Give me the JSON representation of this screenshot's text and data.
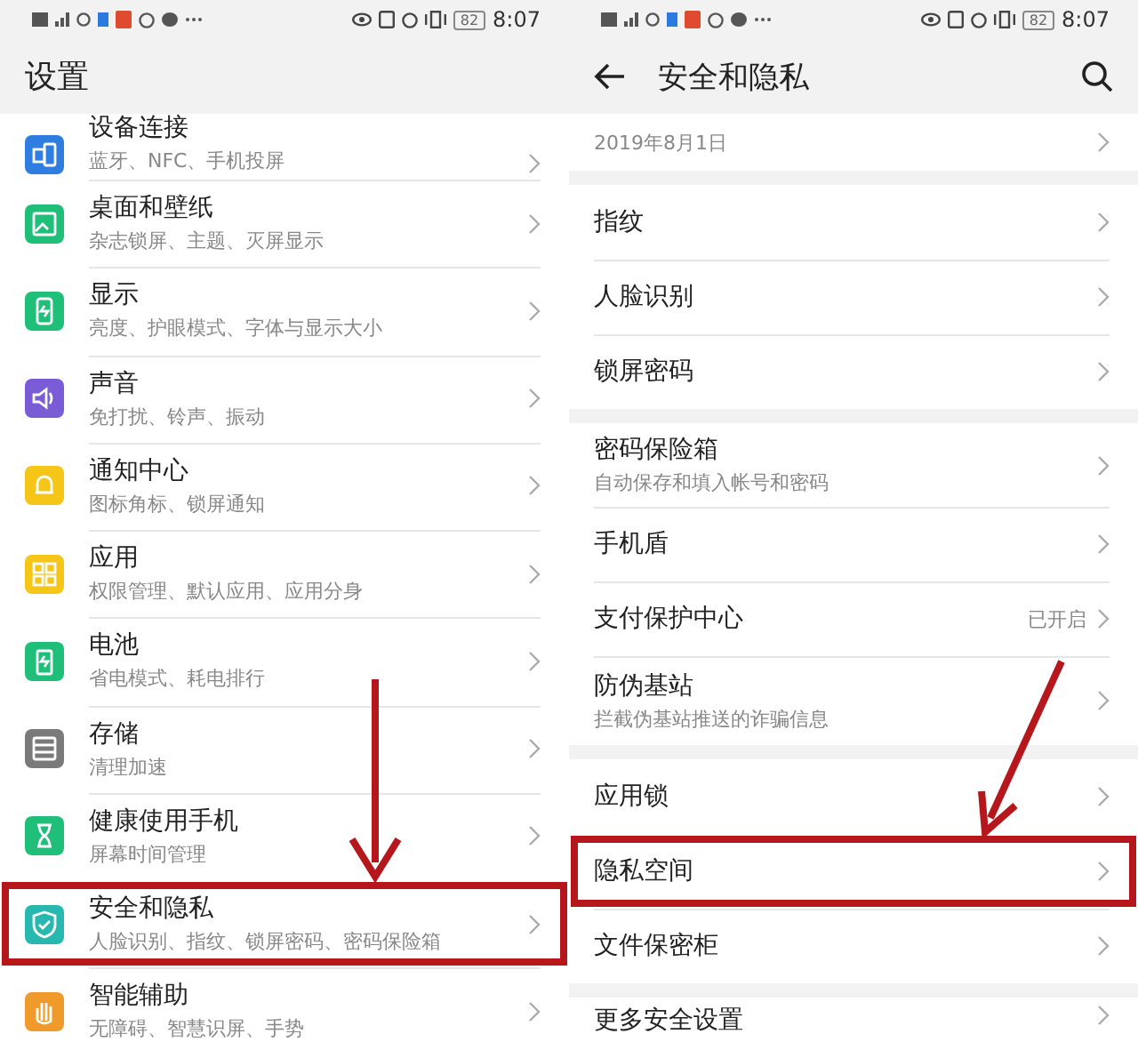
{
  "screens": [
    {
      "status_bar": {
        "battery": "82",
        "time": "8:07"
      },
      "header": {
        "title": "设置",
        "back": false,
        "search": false
      },
      "groups": [
        [
          {
            "title": "设备连接",
            "subtitle": "蓝牙、NFC、手机投屏",
            "color": "#2f7de1",
            "highlighted": false
          },
          {
            "title": "桌面和壁纸",
            "subtitle": "杂志锁屏、主题、灭屏显示",
            "color": "#1fbf7a",
            "highlighted": false
          },
          {
            "title": "显示",
            "subtitle": "亮度、护眼模式、字体与显示大小",
            "color": "#1fbf7a",
            "highlighted": false
          },
          {
            "title": "声音",
            "subtitle": "免打扰、铃声、振动",
            "color": "#7a5cd6",
            "highlighted": false
          },
          {
            "title": "通知中心",
            "subtitle": "图标角标、锁屏通知",
            "color": "#f5c518",
            "highlighted": false
          },
          {
            "title": "应用",
            "subtitle": "权限管理、默认应用、应用分身",
            "color": "#f5c518",
            "highlighted": false
          },
          {
            "title": "电池",
            "subtitle": "省电模式、耗电排行",
            "color": "#1fbf7a",
            "highlighted": false
          },
          {
            "title": "存储",
            "subtitle": "清理加速",
            "color": "#7a7a7a",
            "highlighted": false
          },
          {
            "title": "健康使用手机",
            "subtitle": "屏幕时间管理",
            "color": "#1fbf7a",
            "highlighted": false
          },
          {
            "title": "安全和隐私",
            "subtitle": "人脸识别、指纹、锁屏密码、密码保险箱",
            "color": "#27b8b0",
            "highlighted": true
          },
          {
            "title": "智能辅助",
            "subtitle": "无障碍、智慧识屏、手势",
            "color": "#f09a2c",
            "highlighted": false
          }
        ]
      ]
    },
    {
      "status_bar": {
        "battery": "82",
        "time": "8:07"
      },
      "header": {
        "title": "安全和隐私",
        "back": true,
        "search": true
      },
      "groups": [
        [
          {
            "subtitle": "2019年8月1日",
            "highlighted": false
          }
        ],
        [
          {
            "title": "指纹",
            "highlighted": false
          },
          {
            "title": "人脸识别",
            "highlighted": false
          },
          {
            "title": "锁屏密码",
            "highlighted": false
          }
        ],
        [
          {
            "title": "密码保险箱",
            "subtitle": "自动保存和填入帐号和密码",
            "highlighted": false
          },
          {
            "title": "手机盾",
            "highlighted": false
          },
          {
            "title": "支付保护中心",
            "value": "已开启",
            "highlighted": false
          },
          {
            "title": "防伪基站",
            "subtitle": "拦截伪基站推送的诈骗信息",
            "highlighted": false
          }
        ],
        [
          {
            "title": "应用锁",
            "highlighted": false
          },
          {
            "title": "隐私空间",
            "highlighted": true
          },
          {
            "title": "文件保密柜",
            "highlighted": false
          }
        ],
        [
          {
            "title": "更多安全设置",
            "highlighted": false
          }
        ]
      ]
    }
  ]
}
